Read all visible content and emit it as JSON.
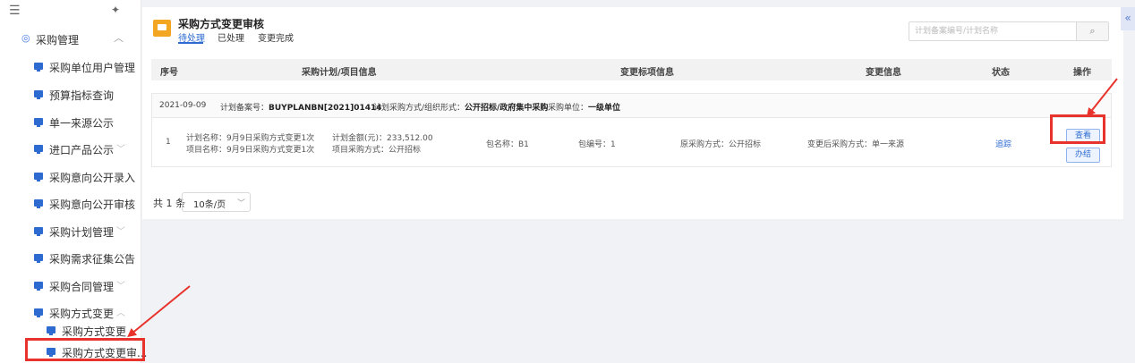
{
  "sidebar": {
    "menu_icon": "menu-icon",
    "pin_icon": "pin-icon",
    "group_label": "采购管理",
    "items": [
      {
        "label": "采购单位用户管理",
        "chevron": false
      },
      {
        "label": "预算指标查询",
        "chevron": false
      },
      {
        "label": "单一来源公示",
        "chevron": false
      },
      {
        "label": "进口产品公示",
        "chevron": true
      },
      {
        "label": "采购意向公开录入",
        "chevron": false
      },
      {
        "label": "采购意向公开审核",
        "chevron": false
      },
      {
        "label": "采购计划管理",
        "chevron": true
      },
      {
        "label": "采购需求征集公告",
        "chevron": true
      },
      {
        "label": "采购合同管理",
        "chevron": true
      },
      {
        "label": "采购方式变更",
        "chevron": true
      }
    ],
    "sub_items": [
      {
        "label": "采购方式变更"
      },
      {
        "label": "采购方式变更审..."
      }
    ]
  },
  "header": {
    "title": "采购方式变更审核",
    "tabs": [
      "待处理",
      "已处理",
      "变更完成"
    ],
    "active_tab": "待处理",
    "search_placeholder": "计划备案编号/计划名称"
  },
  "table": {
    "columns": [
      "序号",
      "采购计划/项目信息",
      "变更标项信息",
      "变更信息",
      "状态",
      "操作"
    ],
    "group": {
      "date": "2021-09-09",
      "plan_no_label": "计划备案号：",
      "plan_no": "BUYPLANBN[2021]01414",
      "method_label": "计划采购方式/组织形式：",
      "method": "公开招标/政府集中采购",
      "unit_label": "采购单位：",
      "unit": "一级单位"
    },
    "rows": [
      {
        "index": "1",
        "plan_name": "计划名称：9月9日采购方式变更1次",
        "project_name": "项目名称：9月9日采购方式变更1次",
        "amount": "计划金额(元)：233,512.00",
        "project_method": "项目采购方式：公开招标",
        "package_name": "包名称：B1",
        "package_no": "包编号：1",
        "orig_method": "原采购方式：公开招标",
        "new_method": "变更后采购方式：单一来源",
        "status": "追踪",
        "actions": [
          "查看",
          "办结"
        ]
      }
    ]
  },
  "pagination": {
    "total": "共 1 条",
    "page_size": "10条/页"
  },
  "collapse_icon": "double-chevron-left-icon",
  "colors": {
    "accent": "#2d6bd1",
    "highlight": "#e8322c",
    "header_icon": "#f2a622"
  }
}
